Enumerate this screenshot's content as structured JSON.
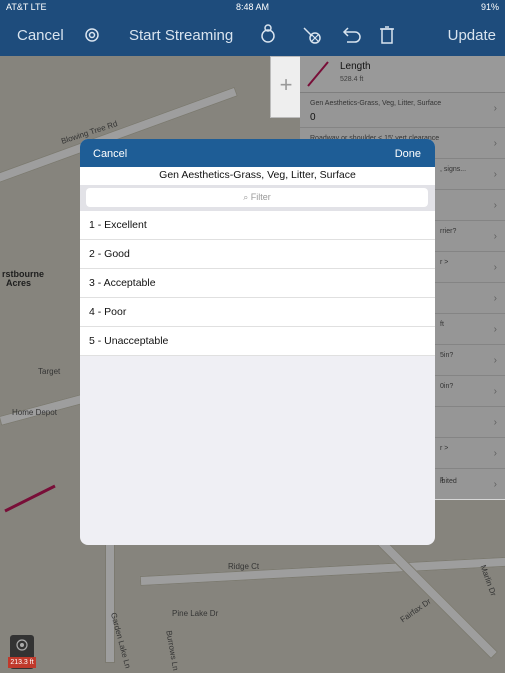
{
  "status": {
    "carrier": "AT&T  LTE",
    "time": "8:48 AM",
    "battery": "91%"
  },
  "toolbar": {
    "cancel": "Cancel",
    "start_streaming": "Start Streaming",
    "update": "Update"
  },
  "map_labels": [
    "Blowing Tree Rd",
    "rstbourne",
    "Acres",
    "Target",
    "Home Depot",
    "Pine Lake Dr",
    "Ridge Ct",
    "Fairfax Dr",
    "Marlin Dr",
    "Garden Lake Ln",
    "Burrows Ln"
  ],
  "panel": {
    "length_title": "Length",
    "length_value": "528.4 ft",
    "rows": [
      {
        "text": "Gen Aesthetics-Grass, Veg, Litter, Surface",
        "value": "0"
      },
      {
        "text": "Roadway or shoulder < 15' vert clearance"
      },
      {
        "text": ", signs..."
      },
      {
        "text": ""
      },
      {
        "text": "rrier?"
      },
      {
        "text": "r >"
      },
      {
        "text": ""
      },
      {
        "text": "ft"
      },
      {
        "text": "5in?"
      },
      {
        "text": "0in?"
      },
      {
        "text": ""
      },
      {
        "text": "r >"
      },
      {
        "text": "s"
      },
      {
        "text": "ibited"
      }
    ]
  },
  "modal": {
    "cancel": "Cancel",
    "done": "Done",
    "title": "Gen Aesthetics-Grass, Veg, Litter, Surface",
    "filter_placeholder": "Filter",
    "options": [
      "1 - Excellent",
      "2 - Good",
      "3 - Acceptable",
      "4 - Poor",
      "5 - Unacceptable"
    ]
  },
  "scale": "213.3 ft",
  "colors": {
    "toolbar": "#1e4c7c",
    "modal_bar": "#1e5d96",
    "line": "#c2185b"
  }
}
